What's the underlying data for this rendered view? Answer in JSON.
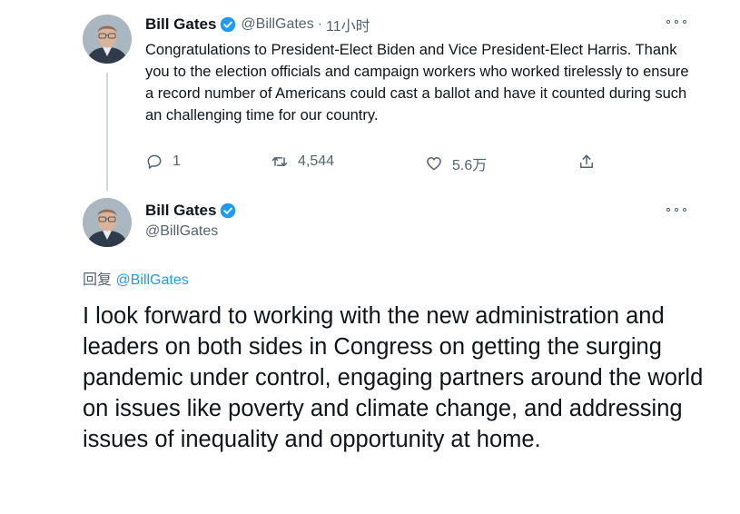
{
  "tweet1": {
    "name": "Bill Gates",
    "handle": "@BillGates",
    "separator": "·",
    "time": "11小时",
    "text": "Congratulations to President-Elect Biden and Vice President-Elect Harris. Thank you to the election officials and campaign workers who worked tirelessly to ensure a record number of Americans could cast a ballot and have it counted during such an challenging time for our country.",
    "replies": "1",
    "retweets": "4,544",
    "likes": "5.6万"
  },
  "tweet2": {
    "name": "Bill Gates",
    "handle": "@BillGates",
    "replying_prefix": "回复",
    "replying_to": "@BillGates",
    "text": "I look forward to working with the new administration and leaders on both sides in Congress on getting the surging pandemic under control, engaging partners around the world on issues like poverty and climate change, and addressing issues of inequality and opportunity at home."
  },
  "colors": {
    "accent": "#1d9bf0",
    "text": "#0f1419",
    "secondary": "#536471",
    "line": "#cfd9de"
  },
  "icons": [
    "verified-badge-icon",
    "more-icon",
    "reply-icon",
    "retweet-icon",
    "like-icon",
    "share-icon"
  ]
}
